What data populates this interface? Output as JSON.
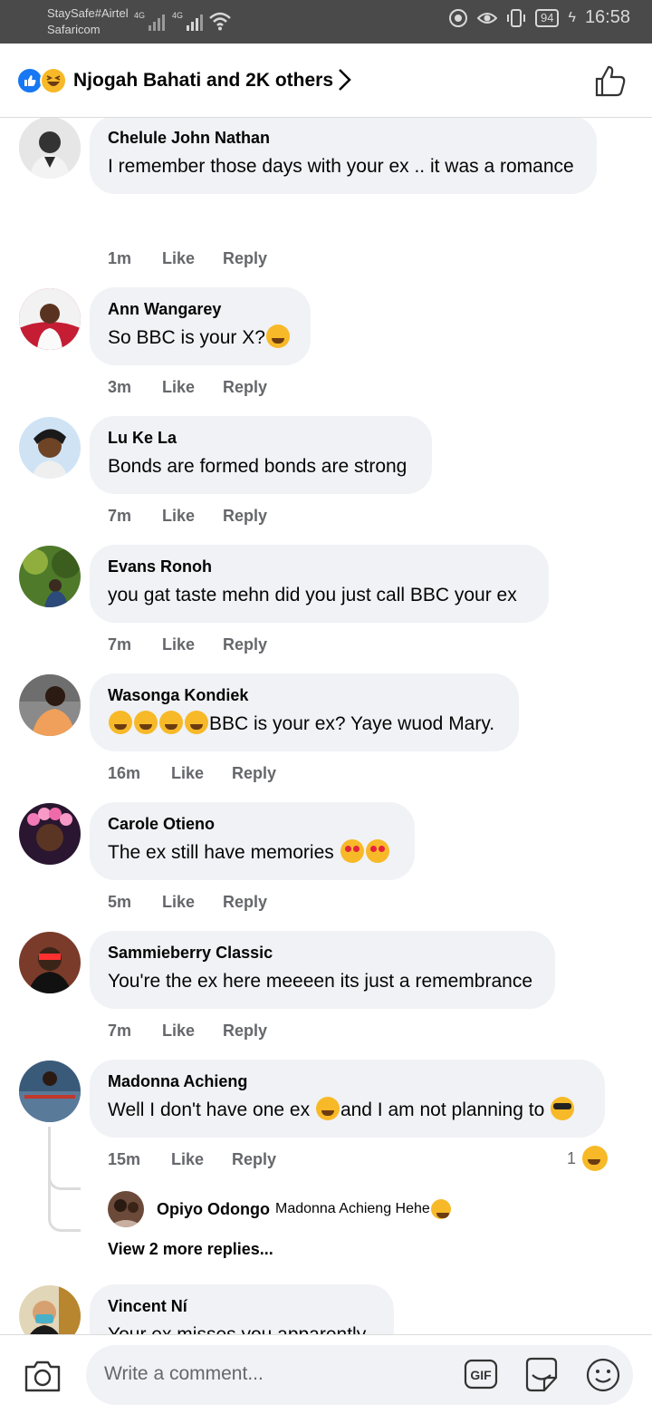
{
  "status_bar": {
    "carrier_1": "StaySafe#Airtel",
    "carrier_2": "Safaricom",
    "net_1": "4G",
    "net_2": "4G",
    "battery": "94",
    "time": "16:58"
  },
  "header": {
    "reactors": "Njogah Bahati and 2K others"
  },
  "comments": [
    {
      "author": "Chelule John Nathan",
      "text": "I remember those days with your ex .. it was a romance",
      "time": "1m",
      "like": "Like",
      "reply": "Reply"
    },
    {
      "author": "Ann Wangarey",
      "text": "So BBC is your X?",
      "time": "3m",
      "like": "Like",
      "reply": "Reply"
    },
    {
      "author": "Lu Ke La",
      "text": "Bonds are formed bonds are strong",
      "time": "7m",
      "like": "Like",
      "reply": "Reply"
    },
    {
      "author": "Evans Ronoh",
      "text": "you gat taste  mehn did you just call BBC your ex",
      "time": "7m",
      "like": "Like",
      "reply": "Reply"
    },
    {
      "author": "Wasonga Kondiek",
      "text": "BBC is your ex? Yaye wuod Mary.",
      "time": "16m",
      "like": "Like",
      "reply": "Reply"
    },
    {
      "author": "Carole Otieno",
      "text": "The ex still have memories ",
      "time": "5m",
      "like": "Like",
      "reply": "Reply"
    },
    {
      "author": "Sammieberry Classic",
      "text": "You're the ex here meeeen its just a remembrance",
      "time": "7m",
      "like": "Like",
      "reply": "Reply"
    },
    {
      "author": "Madonna Achieng",
      "text_1": "Well I don't have one ex ",
      "text_2": "and I am not planning to ",
      "time": "15m",
      "like": "Like",
      "reply": "Reply",
      "reaction_count": "1"
    },
    {
      "author": "Vincent Ní",
      "text": "Your ex misses you apparently"
    }
  ],
  "reply": {
    "author": "Opiyo Odongo",
    "text": "Madonna Achieng Hehe",
    "view_more": "View 2 more replies..."
  },
  "composer": {
    "placeholder": "Write a comment...",
    "gif_label": "GIF"
  }
}
